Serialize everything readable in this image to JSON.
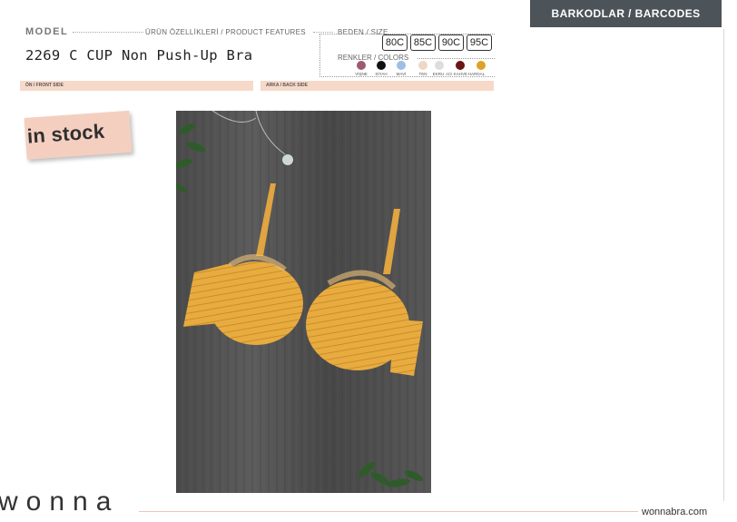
{
  "header": {
    "model_label": "MODEL",
    "features_label": "ÜRÜN ÖZELLİKLERİ / PRODUCT FEATURES",
    "size_label": "BEDEN / SIZE",
    "colors_label": "RENKLER / COLORS",
    "model_name": "2269 C CUP Non Push-Up Bra"
  },
  "sizes": [
    "80C",
    "85C",
    "90C",
    "95C"
  ],
  "colors": [
    {
      "name": "VİŞNE",
      "hex": "#9b5b72"
    },
    {
      "name": "SİYAH",
      "hex": "#111111"
    },
    {
      "name": "MAVİ",
      "hex": "#9ebee6"
    },
    {
      "name": "TEN",
      "hex": "#eed7c5"
    },
    {
      "name": "EKRU",
      "hex": "#dddddd"
    },
    {
      "name": "ACI KAHVE",
      "hex": "#6b1515"
    },
    {
      "name": "HARDAL",
      "hex": "#e0a128"
    }
  ],
  "sections": {
    "front": "ÖN / FRONT SIDE",
    "back": "ARKA / BACK SIDE"
  },
  "barcodes_label": "BARKODLAR / BARCODES",
  "stamp": "in stock",
  "footer": {
    "logo": "wonna",
    "site": "wonnabra.com"
  },
  "theme": {
    "accent": "#f6d9c8",
    "barcode_bg": "#4c5359",
    "product_color": "#e7a83d"
  }
}
